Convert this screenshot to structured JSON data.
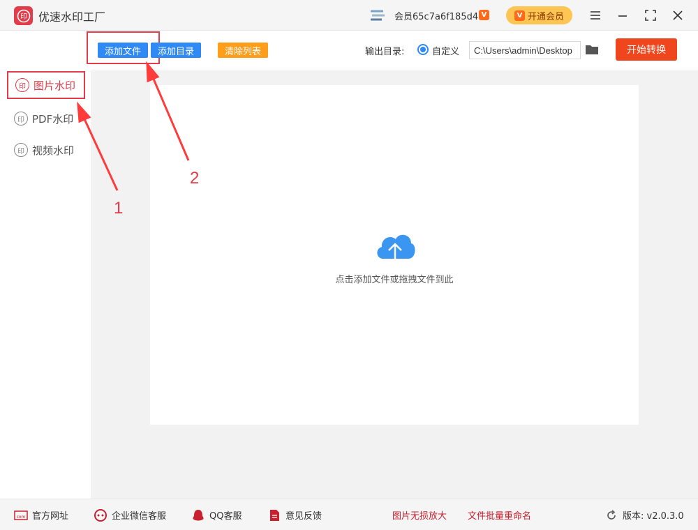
{
  "app": {
    "title": "优速水印工厂",
    "logo_text": "印"
  },
  "header": {
    "member_id": "会员65c7a6f185d4",
    "vip_badge": "V",
    "open_vip": "开通会员"
  },
  "sidebar": {
    "items": [
      {
        "label": "图片水印",
        "icon_text": "印"
      },
      {
        "label": "PDF水印",
        "icon_text": "印"
      },
      {
        "label": "视频水印",
        "icon_text": "印"
      }
    ]
  },
  "toolbar": {
    "add_file": "添加文件",
    "add_dir": "添加目录",
    "clear_list": "清除列表",
    "output_label": "输出目录:",
    "radio_label": "自定义",
    "output_path": "C:\\Users\\admin\\Desktop",
    "start": "开始转换"
  },
  "main": {
    "drop_hint": "点击添加文件或拖拽文件到此"
  },
  "annotations": {
    "one": "1",
    "two": "2"
  },
  "footer": {
    "website": "官方网址",
    "wechat": "企业微信客服",
    "qq": "QQ客服",
    "feedback": "意见反馈",
    "enlarge": "图片无损放大",
    "rename": "文件批量重命名",
    "version": "版本: v2.0.3.0"
  },
  "colors": {
    "accent_red": "#e23b4a",
    "blue": "#2f8af5",
    "orange": "#ff9e1b",
    "start": "#f0461d",
    "vip_gold": "#ffc552"
  }
}
